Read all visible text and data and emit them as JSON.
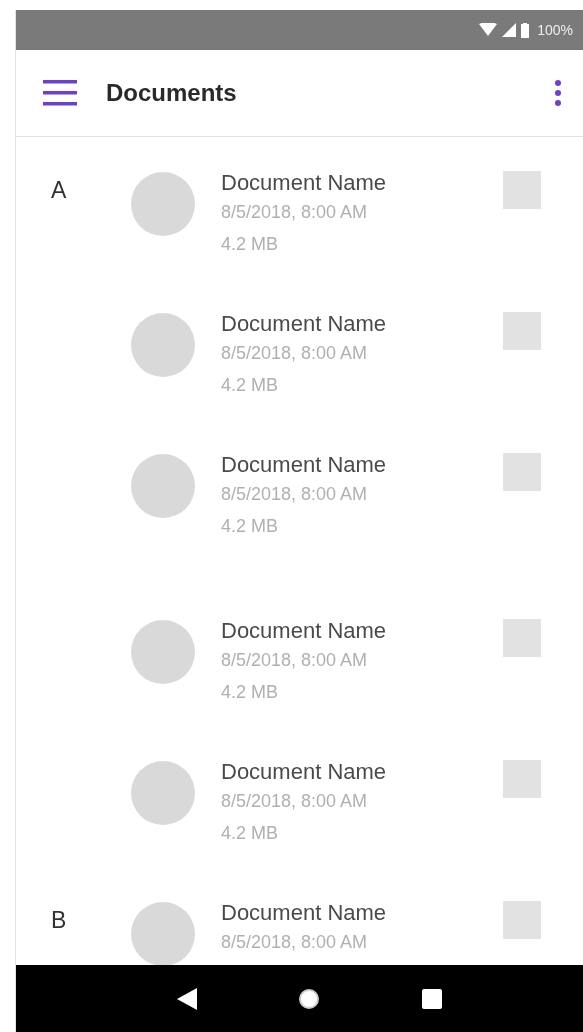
{
  "status_bar": {
    "battery": "100%"
  },
  "app_bar": {
    "title": "Documents"
  },
  "groups": [
    {
      "letter": "A",
      "docs": [
        {
          "name": "Document Name",
          "date": "8/5/2018, 8:00 AM",
          "size": "4.2 MB",
          "checked": false
        },
        {
          "name": "Document Name",
          "date": "8/5/2018, 8:00 AM",
          "size": "4.2 MB",
          "checked": false
        },
        {
          "name": "Document Name",
          "date": "8/5/2018, 8:00 AM",
          "size": "4.2 MB",
          "checked": false
        }
      ]
    },
    {
      "docs": [
        {
          "name": "Document Name",
          "date": "8/5/2018, 8:00 AM",
          "size": "4.2 MB",
          "checked": false
        },
        {
          "name": "Document Name",
          "date": "8/5/2018, 8:00 AM",
          "size": "4.2 MB",
          "checked": false
        }
      ]
    },
    {
      "letter": "B",
      "docs": [
        {
          "name": "Document Name",
          "date": "8/5/2018, 8:00 AM",
          "checked": false
        }
      ]
    }
  ]
}
